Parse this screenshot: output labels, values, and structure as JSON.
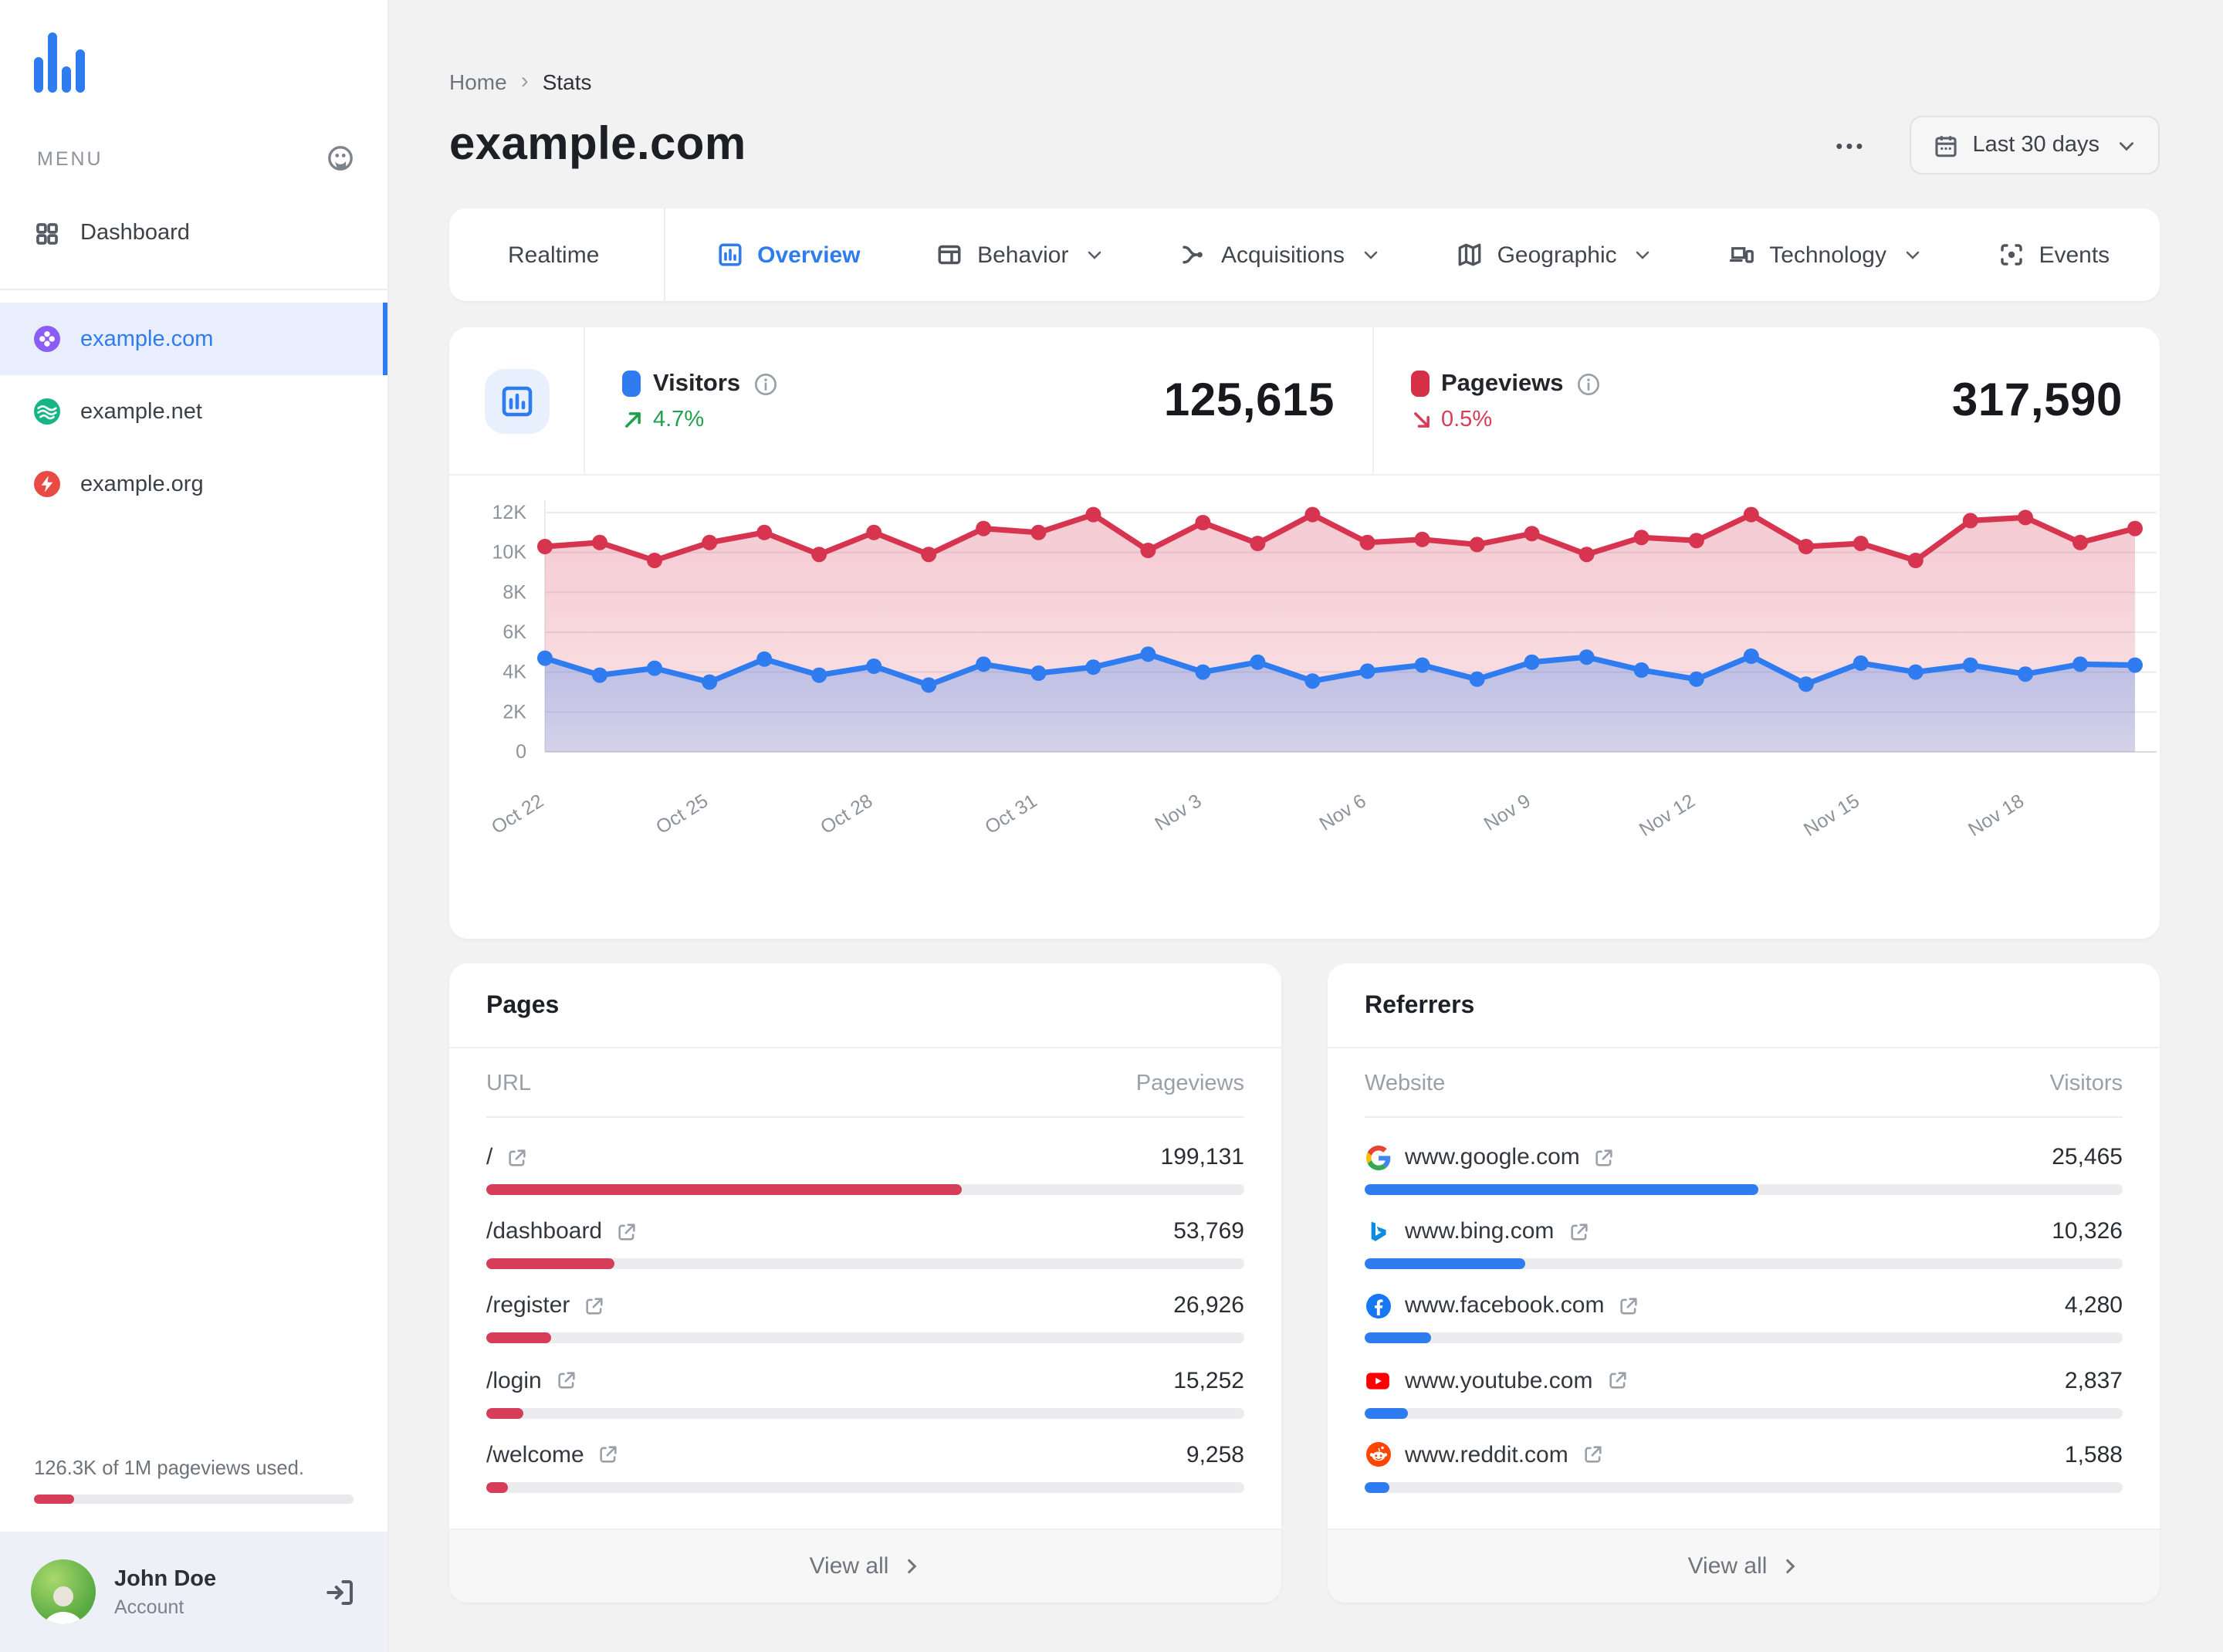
{
  "sidebar": {
    "menu_label": "MENU",
    "dashboard_label": "Dashboard",
    "sites": [
      {
        "name": "example.com",
        "icon": "clover-icon",
        "color": "#8b5cf6",
        "active": true
      },
      {
        "name": "example.net",
        "icon": "waves-icon",
        "color": "#17b585",
        "active": false
      },
      {
        "name": "example.org",
        "icon": "bolt-icon",
        "color": "#ea4a44",
        "active": false
      }
    ],
    "usage_text": "126.3K of 1M pageviews used.",
    "usage_pct": 12.6,
    "usage_color": "#d63d58",
    "user": {
      "name": "John Doe",
      "role": "Account"
    }
  },
  "header": {
    "breadcrumb": [
      "Home",
      "Stats"
    ],
    "title": "example.com",
    "more_label": "•••",
    "date_range": "Last 30 days"
  },
  "tabs": [
    {
      "label": "Realtime",
      "icon": "realtime-dot",
      "chevron": false,
      "active": false
    },
    {
      "label": "Overview",
      "icon": "overview-icon",
      "chevron": false,
      "active": true
    },
    {
      "label": "Behavior",
      "icon": "behavior-icon",
      "chevron": true,
      "active": false
    },
    {
      "label": "Acquisitions",
      "icon": "acquisitions-icon",
      "chevron": true,
      "active": false
    },
    {
      "label": "Geographic",
      "icon": "geographic-icon",
      "chevron": true,
      "active": false
    },
    {
      "label": "Technology",
      "icon": "technology-icon",
      "chevron": true,
      "active": false
    },
    {
      "label": "Events",
      "icon": "events-icon",
      "chevron": false,
      "active": false
    }
  ],
  "stats": [
    {
      "label": "Visitors",
      "color": "#2e7cf0",
      "delta": "4.7%",
      "trend": "up",
      "value": "125,615"
    },
    {
      "label": "Pageviews",
      "color": "#d63048",
      "delta": "0.5%",
      "trend": "down",
      "value": "317,590"
    }
  ],
  "chart_data": {
    "type": "area",
    "title": "Visitors vs Pageviews, last 30 days",
    "x": [
      "Oct 22",
      "Oct 23",
      "Oct 24",
      "Oct 25",
      "Oct 26",
      "Oct 27",
      "Oct 28",
      "Oct 29",
      "Oct 30",
      "Oct 31",
      "Nov 1",
      "Nov 2",
      "Nov 3",
      "Nov 4",
      "Nov 5",
      "Nov 6",
      "Nov 7",
      "Nov 8",
      "Nov 9",
      "Nov 10",
      "Nov 11",
      "Nov 12",
      "Nov 13",
      "Nov 14",
      "Nov 15",
      "Nov 16",
      "Nov 17",
      "Nov 18",
      "Nov 19",
      "Nov 20"
    ],
    "x_tick_every": 3,
    "yticks": [
      0,
      2000,
      4000,
      6000,
      8000,
      10000,
      12000
    ],
    "ytick_labels": [
      "0",
      "2K",
      "4K",
      "6K",
      "8K",
      "10K",
      "12K"
    ],
    "ylim": [
      0,
      12000
    ],
    "grid": true,
    "legend_position": "in-stats-header",
    "series": [
      {
        "name": "Pageviews",
        "color": "#d6344f",
        "values": [
          10300,
          10500,
          9600,
          10500,
          11000,
          9900,
          11000,
          9900,
          11200,
          11000,
          11900,
          10100,
          11500,
          10450,
          11900,
          10500,
          10650,
          10400,
          10950,
          9900,
          10750,
          10600,
          11900,
          10300,
          10450,
          9600,
          11600,
          11750,
          10500,
          11200
        ]
      },
      {
        "name": "Visitors",
        "color": "#2e7cf0",
        "values": [
          4700,
          3850,
          4200,
          3500,
          4650,
          3850,
          4300,
          3350,
          4400,
          3950,
          4250,
          4900,
          4000,
          4500,
          3550,
          4050,
          4350,
          3650,
          4500,
          4750,
          4100,
          3650,
          4800,
          3400,
          4450,
          4000,
          4350,
          3900,
          4400,
          4350
        ]
      }
    ]
  },
  "pages_card": {
    "title": "Pages",
    "col1": "URL",
    "col2": "Pageviews",
    "view_all": "View all",
    "bar_color": "#d63d58",
    "rows": [
      {
        "label": "/",
        "value": "199,131",
        "bar_pct": 62.7
      },
      {
        "label": "/dashboard",
        "value": "53,769",
        "bar_pct": 16.9
      },
      {
        "label": "/register",
        "value": "26,926",
        "bar_pct": 8.5
      },
      {
        "label": "/login",
        "value": "15,252",
        "bar_pct": 4.8
      },
      {
        "label": "/welcome",
        "value": "9,258",
        "bar_pct": 2.9
      }
    ]
  },
  "referrers_card": {
    "title": "Referrers",
    "col1": "Website",
    "col2": "Visitors",
    "view_all": "View all",
    "bar_color": "#2e7cf0",
    "rows": [
      {
        "label": "www.google.com",
        "icon": "google-favicon",
        "value": "25,465",
        "bar_pct": 52.0
      },
      {
        "label": "www.bing.com",
        "icon": "bing-favicon",
        "value": "10,326",
        "bar_pct": 21.1
      },
      {
        "label": "www.facebook.com",
        "icon": "facebook-favicon",
        "value": "4,280",
        "bar_pct": 8.7
      },
      {
        "label": "www.youtube.com",
        "icon": "youtube-favicon",
        "value": "2,837",
        "bar_pct": 5.8
      },
      {
        "label": "www.reddit.com",
        "icon": "reddit-favicon",
        "value": "1,588",
        "bar_pct": 3.2
      }
    ]
  }
}
